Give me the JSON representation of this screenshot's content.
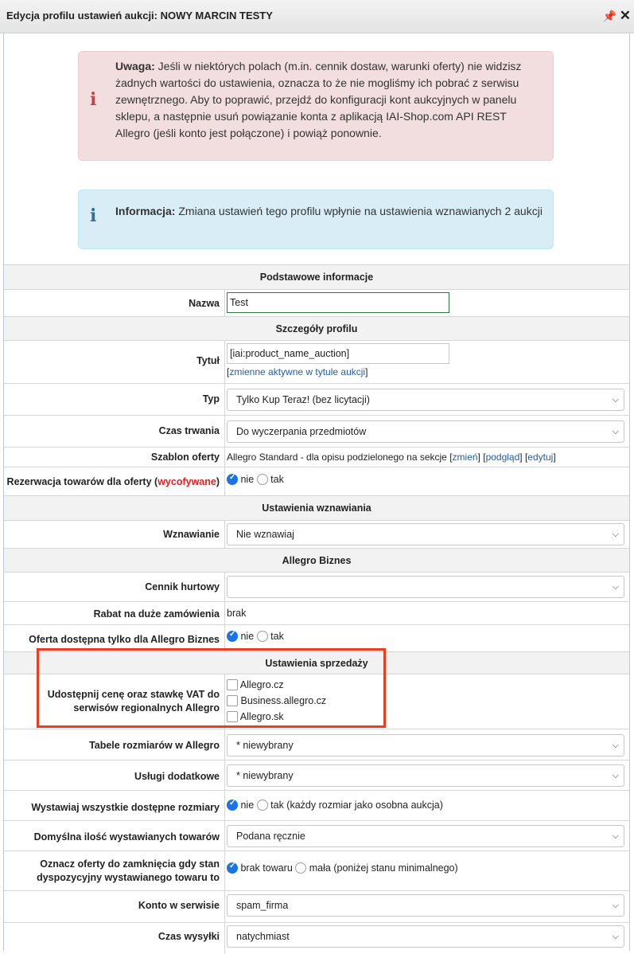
{
  "window": {
    "title": "Edycja profilu ustawień aukcji: NOWY MARCIN TESTY"
  },
  "alerts": {
    "warning": {
      "strong": "Uwaga:",
      "text": " Jeśli w niektórych polach (m.in. cennik dostaw, warunki oferty) nie widzisz żadnych wartości do ustawienia, oznacza to że nie mogliśmy ich pobrać z serwisu zewnętrznego. Aby to poprawić, przejdź do konfiguracji kont aukcyjnych w panelu sklepu, a następnie usuń powiązanie konta z aplikacją IAI-Shop.com API REST Allegro (jeśli konto jest połączone) i powiąż ponownie."
    },
    "info": {
      "strong": "Informacja:",
      "text": " Zmiana ustawień tego profilu wpłynie na ustawienia wznawianych 2 aukcji"
    }
  },
  "sections": {
    "basic": "Podstawowe informacje",
    "profile": "Szczegóły profilu",
    "renewal": "Ustawienia wznawiania",
    "business": "Allegro Biznes",
    "sales": "Ustawienia sprzedaży"
  },
  "fields": {
    "name": {
      "label": "Nazwa",
      "value": "Test"
    },
    "title": {
      "label": "Tytuł",
      "value": "[iai:product_name_auction]",
      "link_open": "[",
      "link": "zmienne aktywne w tytule aukcji",
      "link_close": "]"
    },
    "type": {
      "label": "Typ",
      "value": "Tylko Kup Teraz! (bez licytacji)"
    },
    "duration": {
      "label": "Czas trwania",
      "value": "Do wyczerpania przedmiotów"
    },
    "template": {
      "label": "Szablon oferty",
      "value": "Allegro Standard - dla opisu podzielonego na sekcje ",
      "change": "zmień",
      "preview": "podgląd",
      "edit": "edytuj"
    },
    "reservation": {
      "label_pre": "Rezerwacja towarów dla oferty (",
      "label_red": "wycofywane",
      "label_post": ")",
      "opt_no": "nie",
      "opt_yes": "tak"
    },
    "renewal": {
      "label": "Wznawianie",
      "value": "Nie wznawiaj"
    },
    "wholesale": {
      "label": "Cennik hurtowy",
      "value": ""
    },
    "discount": {
      "label": "Rabat na duże zamówienia",
      "value": "brak"
    },
    "business_only": {
      "label": "Oferta dostępna tylko dla Allegro Biznes",
      "opt_no": "nie",
      "opt_yes": "tak"
    },
    "regional": {
      "label_l1": "Udostępnij cenę oraz stawkę VAT do",
      "label_l2": "serwisów regionalnych Allegro",
      "options": [
        "Allegro.cz",
        "Business.allegro.cz",
        "Allegro.sk"
      ]
    },
    "size_tables": {
      "label": "Tabele rozmiarów w Allegro",
      "value": "* niewybrany"
    },
    "extra_services": {
      "label": "Usługi dodatkowe",
      "value": "* niewybrany"
    },
    "all_sizes": {
      "label": "Wystawiaj wszystkie dostępne rozmiary",
      "opt_no": "nie",
      "opt_yes": "tak (każdy rozmiar jako osobna aukcja)"
    },
    "default_qty": {
      "label": "Domyślna ilość wystawianych towarów",
      "value": "Podana ręcznie"
    },
    "close_mark": {
      "label_l1": "Oznacz oferty do zamknięcia gdy stan",
      "label_l2": "dyspozycyjny wystawianego towaru to",
      "opt_1": "brak towaru",
      "opt_2": "mała (poniżej stanu minimalnego)"
    },
    "account": {
      "label": "Konto w serwisie",
      "value": "spam_firma"
    },
    "shipping_time": {
      "label": "Czas wysyłki",
      "value": "natychmiast"
    }
  }
}
